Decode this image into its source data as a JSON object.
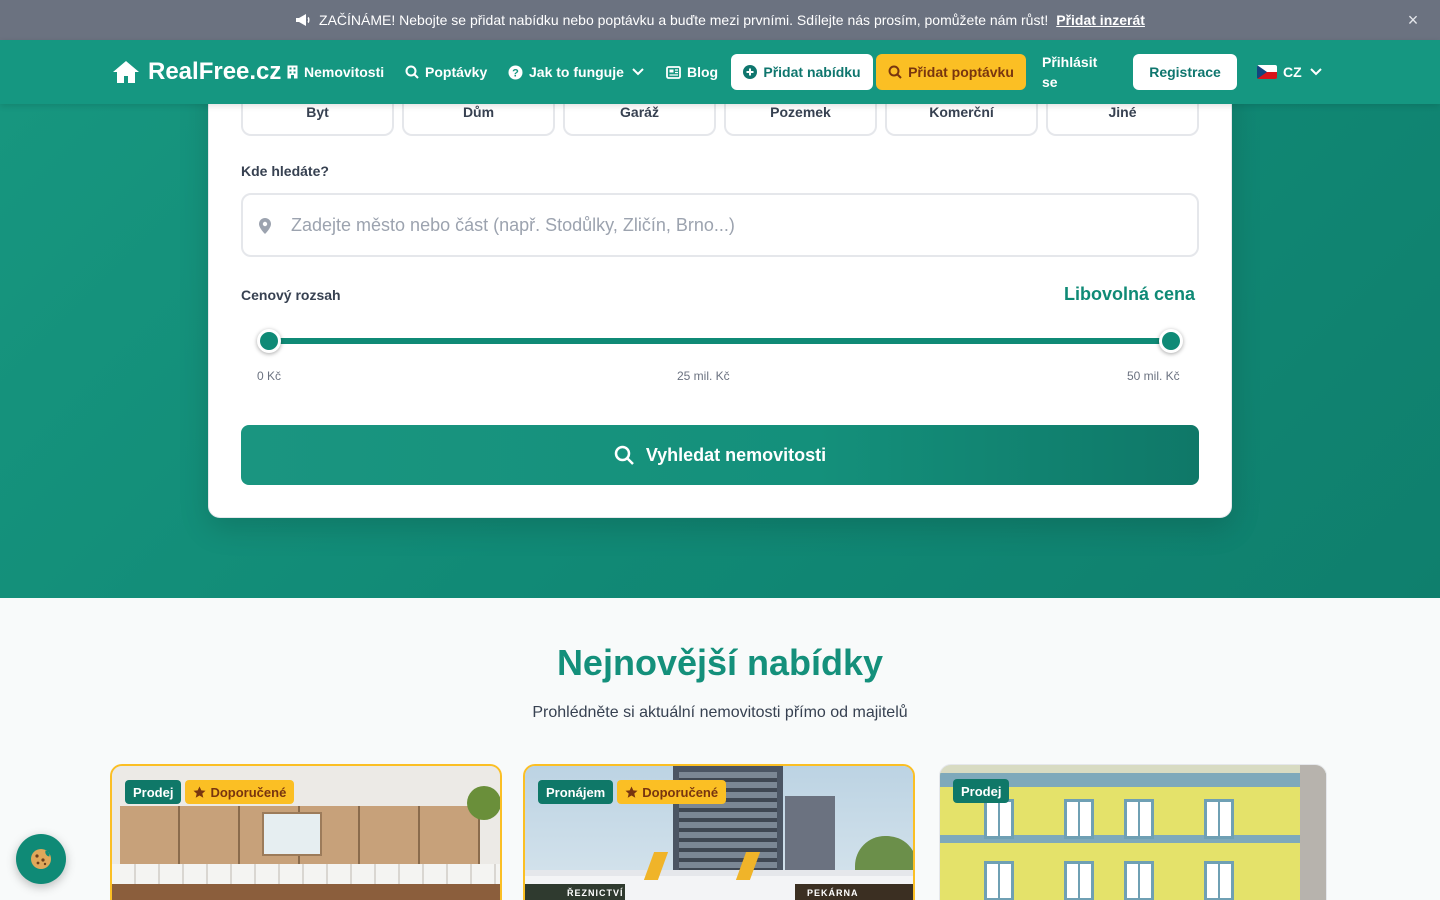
{
  "announcement": {
    "text": "ZAČÍNÁME! Nebojte se přidat nabídku nebo poptávku a buďte mezi prvními. Sdílejte nás prosím, pomůžete nám růst!",
    "link": "Přidat inzerát",
    "close": "×"
  },
  "header": {
    "brand": "RealFree.cz",
    "nav": {
      "properties": "Nemovitosti",
      "demands": "Poptávky",
      "how": "Jak to funguje",
      "blog": "Blog"
    },
    "add_offer": "Přidat nabídku",
    "add_demand": "Přidat poptávku",
    "login": "Přihlásit se",
    "register": "Registrace",
    "language": "CZ"
  },
  "search": {
    "property_types": [
      "Byt",
      "Dům",
      "Garáž",
      "Pozemek",
      "Komerční",
      "Jiné"
    ],
    "location_label": "Kde hledáte?",
    "location_placeholder": "Zadejte město nebo část (např. Stodůlky, Zličín, Brno...)",
    "price_label": "Cenový rozsah",
    "price_value": "Libovolná cena",
    "price_range": {
      "min_fraction": 0.0,
      "max_fraction": 1.0
    },
    "ticks": [
      "0 Kč",
      "25 mil. Kč",
      "50 mil. Kč"
    ],
    "submit": "Vyhledat nemovitosti"
  },
  "newest": {
    "title": "Nejnovější nabídky",
    "subtitle": "Prohlédněte si aktuální nemovitosti přímo od majitelů",
    "listings": [
      {
        "type": "Prodej",
        "featured": "Doporučené"
      },
      {
        "type": "Pronájem",
        "featured": "Doporučené",
        "shop_left": "ŘEZNICTVÍ",
        "shop_right": "PEKÁRNA"
      },
      {
        "type": "Prodej"
      }
    ]
  },
  "colors": {
    "primary": "#159781",
    "accent": "#fbbf24",
    "announcement_bg": "#6b7280"
  },
  "icons": {
    "announcement": "megaphone-icon",
    "home": "home-icon",
    "building": "building-icon",
    "search": "search-icon",
    "help": "question-circle-icon",
    "blog": "newspaper-icon",
    "plus": "plus-circle-icon",
    "location": "map-pin-icon",
    "star": "star-icon",
    "cookie": "cookie-icon"
  }
}
